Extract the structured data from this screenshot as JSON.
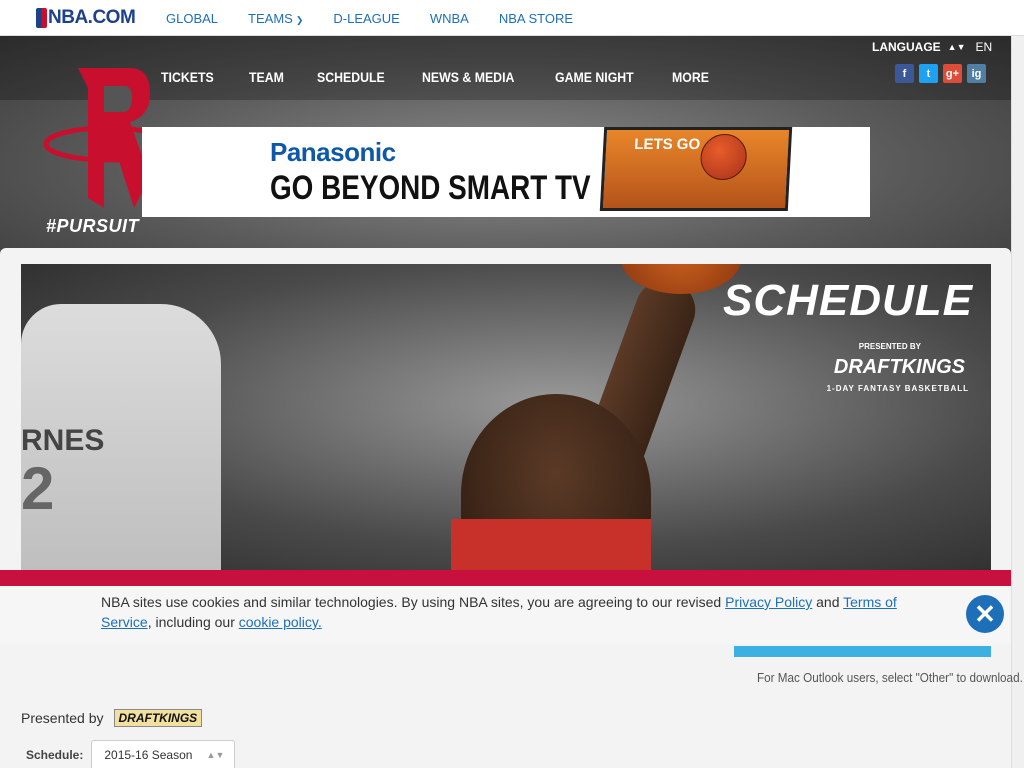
{
  "nba_bar": {
    "logo_text": "NBA.COM",
    "links": [
      {
        "label": "GLOBAL"
      },
      {
        "label": "TEAMS",
        "has_caret": true
      },
      {
        "label": "D-LEAGUE"
      },
      {
        "label": "WNBA"
      },
      {
        "label": "NBA STORE"
      }
    ]
  },
  "header": {
    "nav": [
      "TICKETS",
      "TEAM",
      "SCHEDULE",
      "NEWS & MEDIA",
      "GAME NIGHT",
      "MORE"
    ],
    "language_label": "LANGUAGE",
    "language_value": "EN",
    "social": [
      "f",
      "t",
      "g+",
      "ig"
    ],
    "hashtag": "#PURSUIT"
  },
  "ad": {
    "brand": "Panasonic",
    "tagline": "GO BEYOND SMART TV",
    "screen_text": "LETS GO"
  },
  "banner": {
    "title": "SCHEDULE",
    "presented_by": "PRESENTED BY",
    "sponsor": "DRAFTKINGS",
    "sponsor_sub": "1-DAY FANTASY BASKETBALL",
    "left_player_name": "RNES",
    "left_player_number": "2"
  },
  "cookie": {
    "text_1": "NBA sites use cookies and similar technologies. By using NBA sites, you are agreeing to our revised ",
    "link_privacy": "Privacy Policy",
    "text_2": " and ",
    "link_terms": "Terms of Service",
    "text_3": ", including our ",
    "link_cookie": "cookie policy."
  },
  "download": {
    "mac_note": "For Mac Outlook users, select \"Other\" to download."
  },
  "presented": {
    "label": "Presented by",
    "sponsor": "DRAFTKINGS"
  },
  "schedule_select": {
    "label": "Schedule:",
    "value": "2015-16 Season"
  },
  "colors": {
    "nba_blue": "#1d428a",
    "link_blue": "#1d6fb8",
    "rockets_red": "#c8103e"
  }
}
